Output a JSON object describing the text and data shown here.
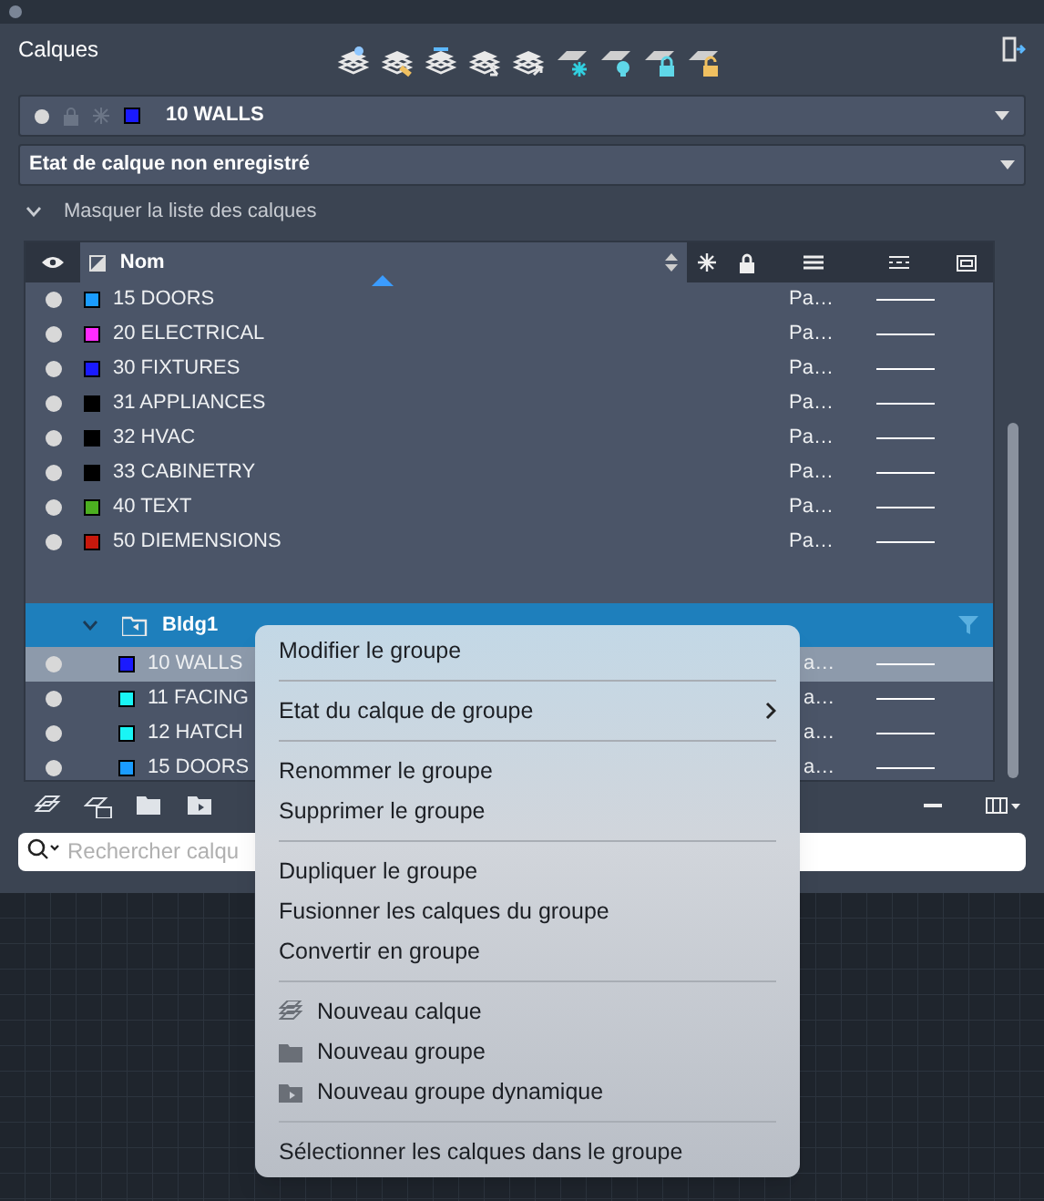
{
  "panel": {
    "title": "Calques"
  },
  "current_layer": {
    "name": "10 WALLS",
    "color": "#1a1aff"
  },
  "layer_state": {
    "value": "Etat de calque non enregistré"
  },
  "toggle": {
    "label": "Masquer la liste des calques",
    "expanded": true
  },
  "table": {
    "columns": [
      {
        "label": "Nom"
      }
    ],
    "rows": [
      {
        "name": "15 DOORS",
        "color": "#1a9cff",
        "on": true,
        "column_4": "Pa…"
      },
      {
        "name": "20 ELECTRICAL",
        "color": "#ff2bff",
        "on": true,
        "column_4": "Pa…"
      },
      {
        "name": "30 FIXTURES",
        "color": "#1a1aff",
        "on": true,
        "column_4": "Pa…"
      },
      {
        "name": "31 APPLIANCES",
        "color": "#000000",
        "on": true,
        "column_4": "Pa…"
      },
      {
        "name": "32 HVAC",
        "color": "#000000",
        "on": true,
        "column_4": "Pa…"
      },
      {
        "name": "33 CABINETRY",
        "color": "#000000",
        "on": true,
        "column_4": "Pa…"
      },
      {
        "name": "40 TEXT",
        "color": "#4caf20",
        "on": true,
        "column_4": "Pa…"
      },
      {
        "name": "50 DIEMENSIONS",
        "color": "#c8180c",
        "on": true,
        "column_4": "Pa…"
      }
    ],
    "group": {
      "name": "Bldg1",
      "expanded": true,
      "selected": true,
      "children": [
        {
          "name": "10 WALLS",
          "color": "#1a1aff",
          "on": true,
          "selected": true,
          "column_4": "a…"
        },
        {
          "name": "11 FACING",
          "color": "#19f5f5",
          "on": true,
          "selected": false,
          "column_4": "a…"
        },
        {
          "name": "12 HATCH",
          "color": "#19f5f5",
          "on": true,
          "selected": false,
          "column_4": "a…"
        },
        {
          "name": "15 DOORS",
          "color": "#1a9cff",
          "on": true,
          "selected": false,
          "column_4": "a…"
        }
      ]
    }
  },
  "search": {
    "placeholder": "Rechercher calqu"
  },
  "context_menu": {
    "sections": [
      [
        {
          "label": "Modifier le groupe",
          "kind": "plain"
        }
      ],
      [
        {
          "label": "Etat du calque de groupe",
          "kind": "submenu"
        }
      ],
      [
        {
          "label": "Renommer le groupe",
          "kind": "plain"
        },
        {
          "label": "Supprimer le groupe",
          "kind": "plain"
        }
      ],
      [
        {
          "label": "Dupliquer le groupe",
          "kind": "plain"
        },
        {
          "label": "Fusionner les calques du groupe",
          "kind": "plain"
        },
        {
          "label": "Convertir en groupe",
          "kind": "plain"
        }
      ],
      [
        {
          "label": "Nouveau calque",
          "kind": "new-layer"
        },
        {
          "label": "Nouveau groupe",
          "kind": "new-group"
        },
        {
          "label": "Nouveau groupe dynamique",
          "kind": "new-dynamic-group"
        }
      ],
      [
        {
          "label": "Sélectionner les calques dans le groupe",
          "kind": "plain"
        }
      ]
    ]
  }
}
